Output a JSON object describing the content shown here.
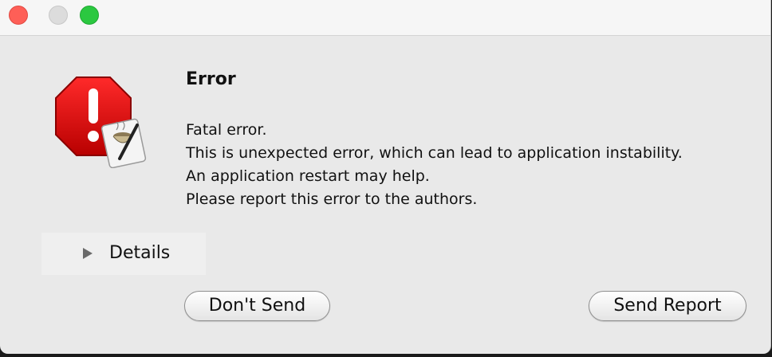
{
  "window": {
    "title": ""
  },
  "dialog": {
    "icon": "error-stop-sign-icon",
    "title": "Error",
    "message_lines": [
      "Fatal error.",
      "This is unexpected error, which can lead to application instability.",
      "An application restart may help.",
      "Please report this error to the authors."
    ],
    "details_label": "Details",
    "details_expanded": false
  },
  "buttons": {
    "dont_send": "Don't Send",
    "send_report": "Send Report"
  },
  "colors": {
    "close": "#fe5f57",
    "minimize_disabled": "#dcdcdc",
    "maximize": "#2bc840",
    "stop_sign": "#d80000"
  }
}
